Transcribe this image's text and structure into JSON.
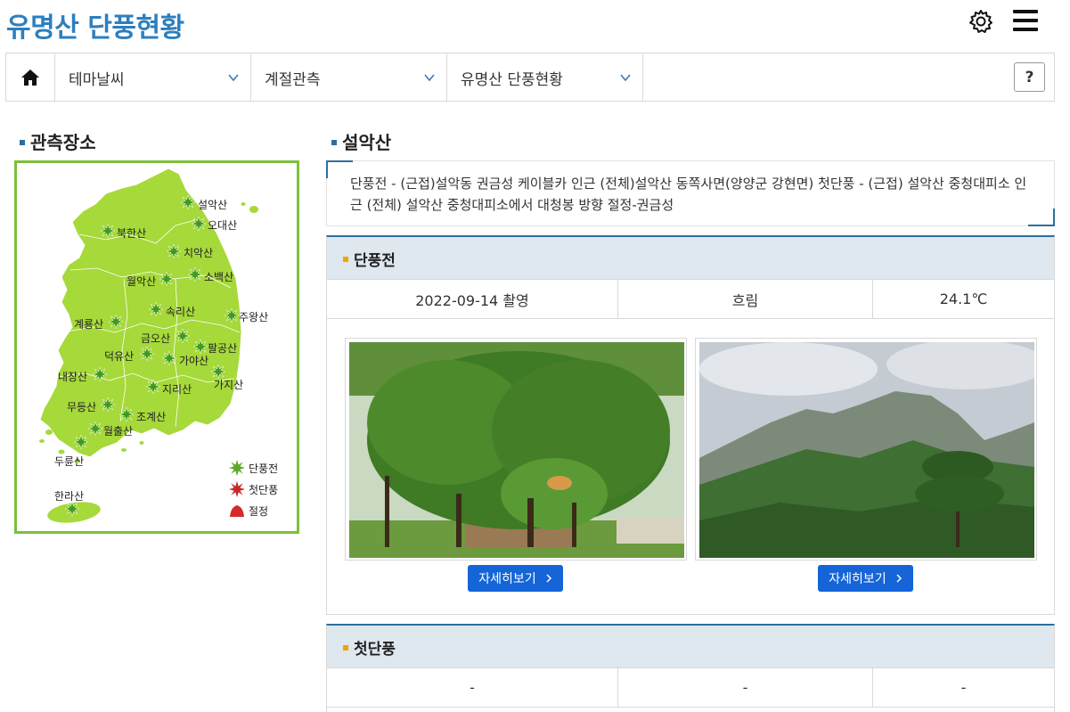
{
  "header": {
    "title": "유명산 단풍현황",
    "settings_icon": "gear-icon",
    "menu_icon": "hamburger-icon"
  },
  "nav": {
    "home_icon": "home-icon",
    "items": [
      {
        "label": "테마날씨"
      },
      {
        "label": "계절관측"
      },
      {
        "label": "유명산 단풍현황"
      }
    ],
    "help_label": "?"
  },
  "left": {
    "heading": "관측장소",
    "mountains": [
      {
        "name": "설악산"
      },
      {
        "name": "오대산"
      },
      {
        "name": "북한산"
      },
      {
        "name": "치악산"
      },
      {
        "name": "월악산"
      },
      {
        "name": "소백산"
      },
      {
        "name": "속리산"
      },
      {
        "name": "주왕산"
      },
      {
        "name": "계룡산"
      },
      {
        "name": "금오산"
      },
      {
        "name": "팔공산"
      },
      {
        "name": "덕유산"
      },
      {
        "name": "가야산"
      },
      {
        "name": "내장산"
      },
      {
        "name": "가지산"
      },
      {
        "name": "지리산"
      },
      {
        "name": "무등산"
      },
      {
        "name": "조계산"
      },
      {
        "name": "월출산"
      },
      {
        "name": "두륜산"
      },
      {
        "name": "한라산"
      }
    ],
    "legend": [
      {
        "label": "단풍전",
        "color": "#5aa82a"
      },
      {
        "label": "첫단풍",
        "color": "#c8282a"
      },
      {
        "label": "절정",
        "color": "#d42a2a"
      }
    ]
  },
  "right": {
    "heading": "설악산",
    "description": "단풍전 - (근접)설악동 권금성 케이블카 인근 (전체)설악산 동쪽사면(양양군 강현면) 첫단풍 - (근접) 설악산 중청대피소 인근 (전체) 설악산 중청대피소에서 대청봉 방향 절정-권금성",
    "stage1": {
      "title": "단풍전",
      "date": "2022-09-14 촬영",
      "weather": "흐림",
      "temp": "24.1℃",
      "more_label": "자세히보기"
    },
    "stage2": {
      "title": "첫단풍",
      "date": "-",
      "weather": "-",
      "temp": "-"
    }
  },
  "colors": {
    "accent": "#2c7fbf",
    "map_green": "#a6d93a",
    "map_border": "#7cc03a",
    "button_blue": "#1565d8",
    "panel_head": "#dfe7ef"
  }
}
